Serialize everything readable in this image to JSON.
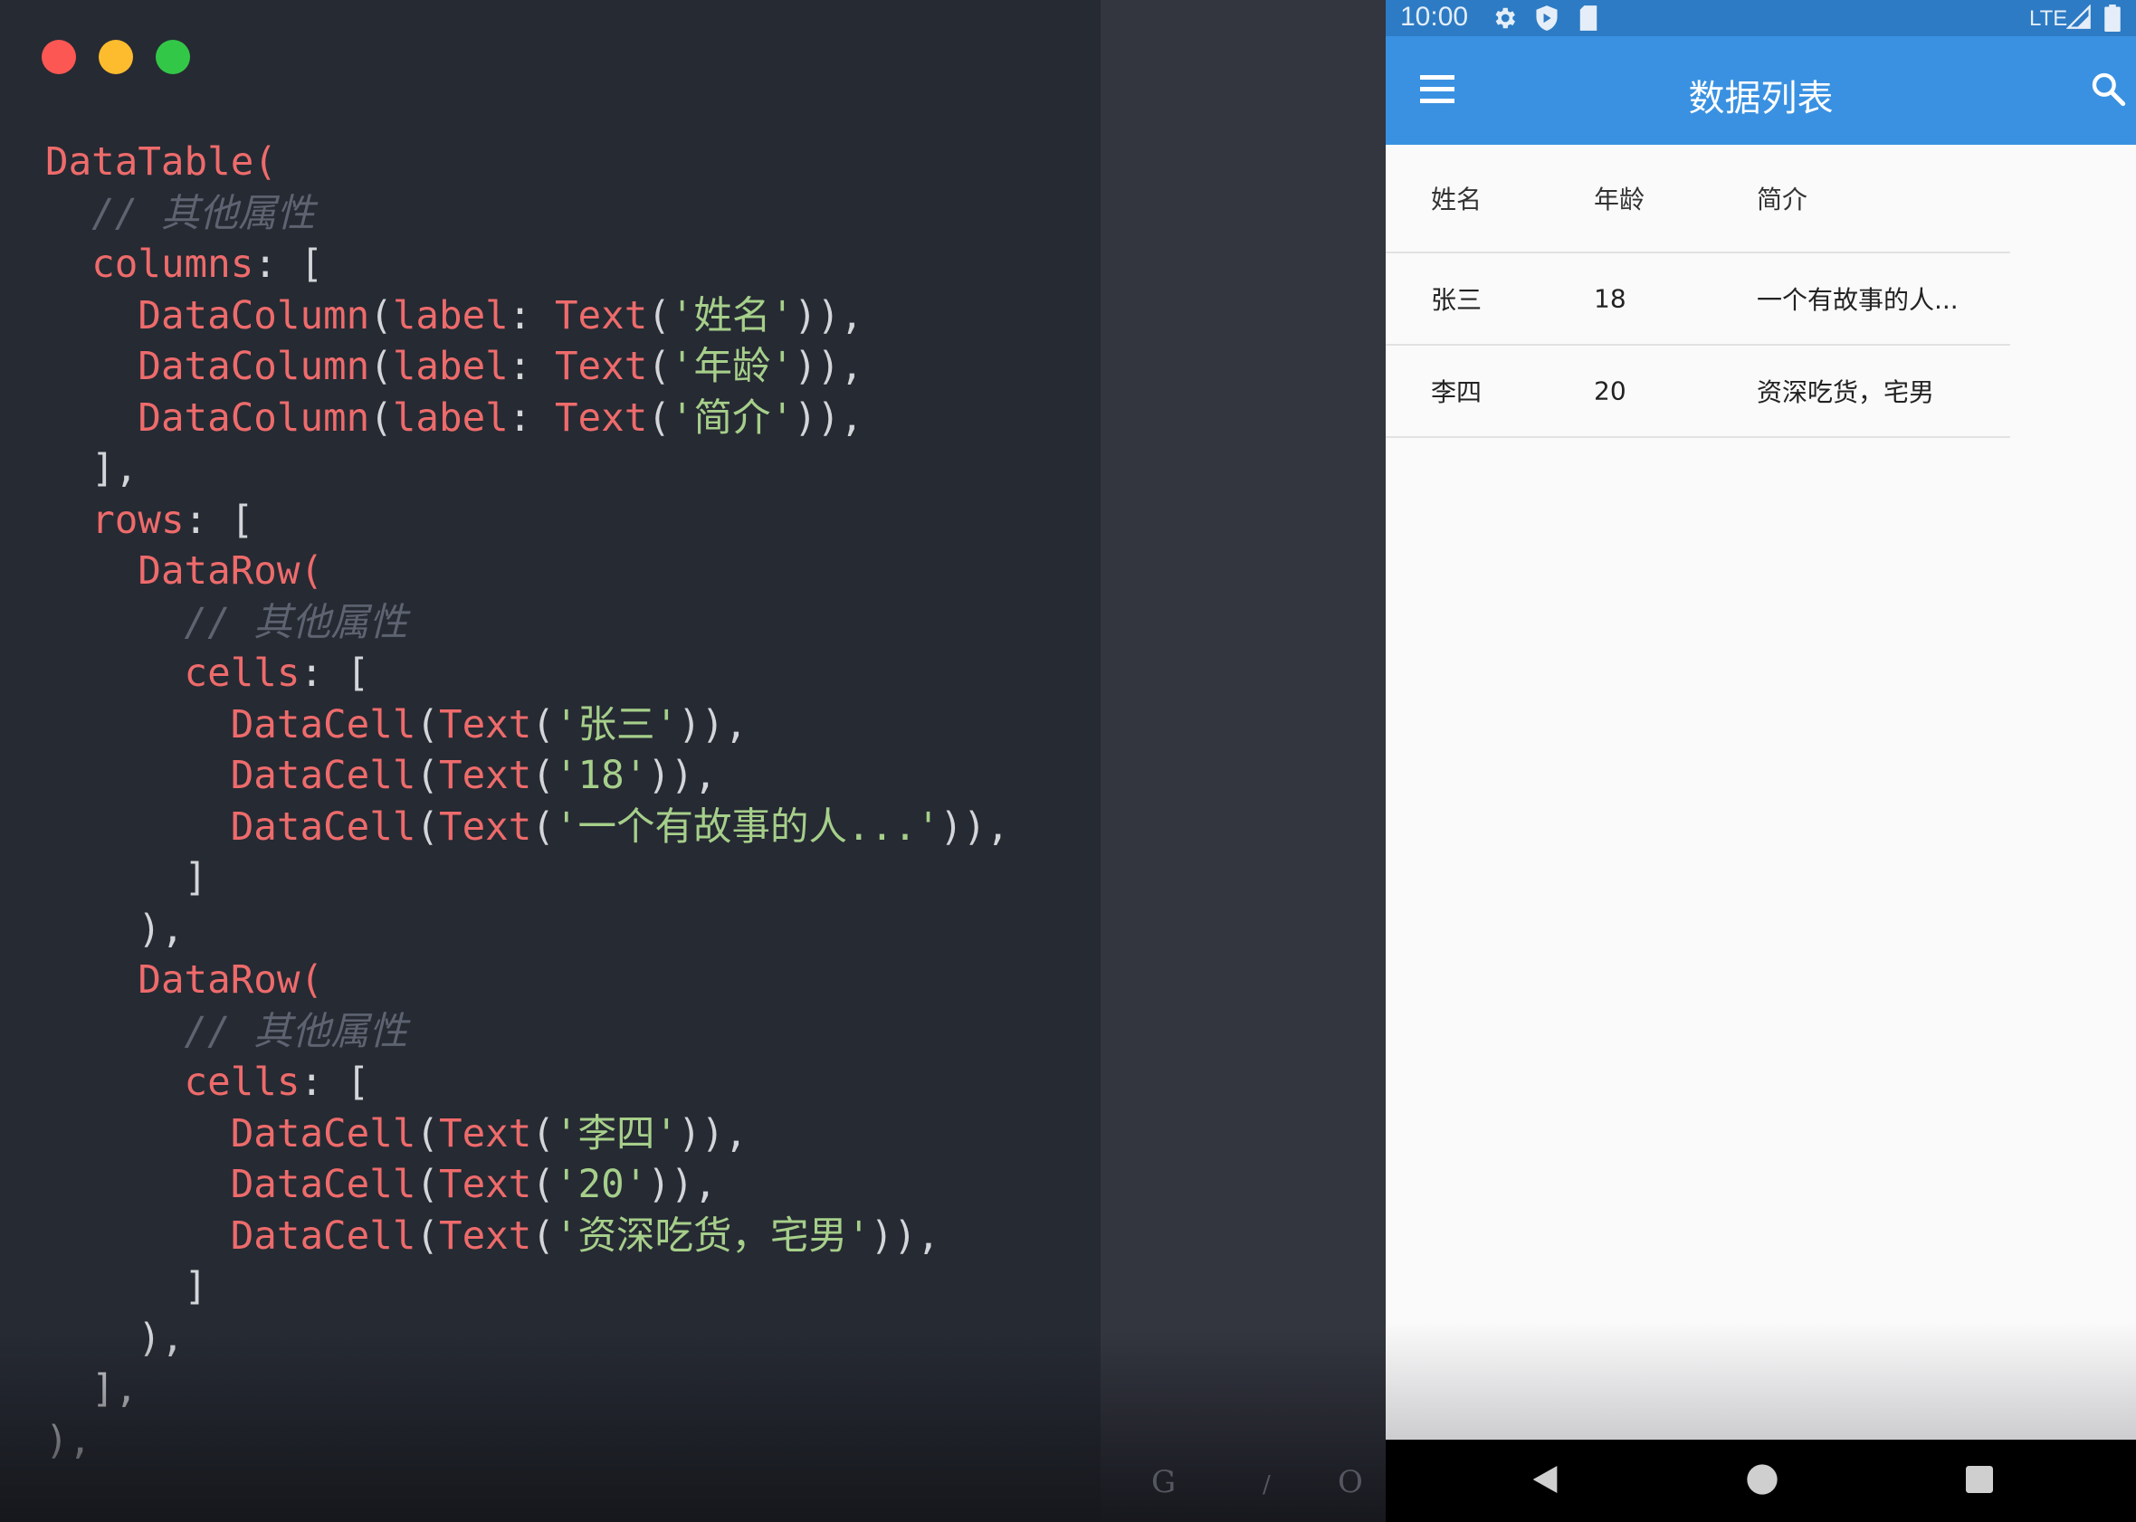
{
  "editor": {
    "lines": [
      [
        {
          "t": "DataTable(",
          "c": "k"
        }
      ],
      [
        {
          "t": "  "
        },
        {
          "t": "// 其他属性",
          "c": "c"
        }
      ],
      [
        {
          "t": "  "
        },
        {
          "t": "columns",
          "c": "k"
        },
        {
          "t": ": ["
        }
      ],
      [
        {
          "t": "    "
        },
        {
          "t": "DataColumn",
          "c": "k"
        },
        {
          "t": "("
        },
        {
          "t": "label",
          "c": "k"
        },
        {
          "t": ": "
        },
        {
          "t": "Text",
          "c": "k"
        },
        {
          "t": "("
        },
        {
          "t": "'姓名'",
          "c": "s"
        },
        {
          "t": ")),"
        }
      ],
      [
        {
          "t": "    "
        },
        {
          "t": "DataColumn",
          "c": "k"
        },
        {
          "t": "("
        },
        {
          "t": "label",
          "c": "k"
        },
        {
          "t": ": "
        },
        {
          "t": "Text",
          "c": "k"
        },
        {
          "t": "("
        },
        {
          "t": "'年龄'",
          "c": "s"
        },
        {
          "t": ")),"
        }
      ],
      [
        {
          "t": "    "
        },
        {
          "t": "DataColumn",
          "c": "k"
        },
        {
          "t": "("
        },
        {
          "t": "label",
          "c": "k"
        },
        {
          "t": ": "
        },
        {
          "t": "Text",
          "c": "k"
        },
        {
          "t": "("
        },
        {
          "t": "'简介'",
          "c": "s"
        },
        {
          "t": ")),"
        }
      ],
      [
        {
          "t": "  ],"
        }
      ],
      [
        {
          "t": "  "
        },
        {
          "t": "rows",
          "c": "k"
        },
        {
          "t": ": ["
        }
      ],
      [
        {
          "t": "    "
        },
        {
          "t": "DataRow(",
          "c": "k"
        }
      ],
      [
        {
          "t": "      "
        },
        {
          "t": "// 其他属性",
          "c": "c"
        }
      ],
      [
        {
          "t": "      "
        },
        {
          "t": "cells",
          "c": "k"
        },
        {
          "t": ": ["
        }
      ],
      [
        {
          "t": "        "
        },
        {
          "t": "DataCell",
          "c": "k"
        },
        {
          "t": "("
        },
        {
          "t": "Text",
          "c": "k"
        },
        {
          "t": "("
        },
        {
          "t": "'张三'",
          "c": "s"
        },
        {
          "t": ")),"
        }
      ],
      [
        {
          "t": "        "
        },
        {
          "t": "DataCell",
          "c": "k"
        },
        {
          "t": "("
        },
        {
          "t": "Text",
          "c": "k"
        },
        {
          "t": "("
        },
        {
          "t": "'18'",
          "c": "s"
        },
        {
          "t": ")),"
        }
      ],
      [
        {
          "t": "        "
        },
        {
          "t": "DataCell",
          "c": "k"
        },
        {
          "t": "("
        },
        {
          "t": "Text",
          "c": "k"
        },
        {
          "t": "("
        },
        {
          "t": "'一个有故事的人...'",
          "c": "s"
        },
        {
          "t": ")),"
        }
      ],
      [
        {
          "t": "      ]"
        }
      ],
      [
        {
          "t": "    ),"
        }
      ],
      [
        {
          "t": "    "
        },
        {
          "t": "DataRow(",
          "c": "k"
        }
      ],
      [
        {
          "t": "      "
        },
        {
          "t": "// 其他属性",
          "c": "c"
        }
      ],
      [
        {
          "t": "      "
        },
        {
          "t": "cells",
          "c": "k"
        },
        {
          "t": ": ["
        }
      ],
      [
        {
          "t": "        "
        },
        {
          "t": "DataCell",
          "c": "k"
        },
        {
          "t": "("
        },
        {
          "t": "Text",
          "c": "k"
        },
        {
          "t": "("
        },
        {
          "t": "'李四'",
          "c": "s"
        },
        {
          "t": ")),"
        }
      ],
      [
        {
          "t": "        "
        },
        {
          "t": "DataCell",
          "c": "k"
        },
        {
          "t": "("
        },
        {
          "t": "Text",
          "c": "k"
        },
        {
          "t": "("
        },
        {
          "t": "'20'",
          "c": "s"
        },
        {
          "t": ")),"
        }
      ],
      [
        {
          "t": "        "
        },
        {
          "t": "DataCell",
          "c": "k"
        },
        {
          "t": "("
        },
        {
          "t": "Text",
          "c": "k"
        },
        {
          "t": "("
        },
        {
          "t": "'资深吃货，宅男'",
          "c": "s"
        },
        {
          "t": ")),"
        }
      ],
      [
        {
          "t": "      ]"
        }
      ],
      [
        {
          "t": "    ),"
        }
      ],
      [
        {
          "t": "  ],"
        }
      ],
      [
        {
          "t": "),"
        }
      ]
    ]
  },
  "watermark": [
    "G",
    "/",
    "O"
  ],
  "phone": {
    "status_bar": {
      "time": "10:00",
      "network": "LTE",
      "icons": [
        "gear-icon",
        "shield-icon",
        "sim-card-icon",
        "signal-icon",
        "battery-icon"
      ]
    },
    "app_bar": {
      "title": "数据列表",
      "icons": [
        "menu-icon",
        "search-icon"
      ]
    },
    "table": {
      "columns": [
        "姓名",
        "年龄",
        "简介"
      ],
      "rows": [
        [
          "张三",
          "18",
          "一个有故事的人..."
        ],
        [
          "李四",
          "20",
          "资深吃货，宅男"
        ]
      ]
    },
    "nav_bar": {
      "icons": [
        "back-icon",
        "home-icon",
        "recents-icon"
      ]
    }
  },
  "colors": {
    "editor_bg": "#262a33",
    "keyword": "#ee6b6b",
    "string": "#a6cf8a",
    "comment": "#5d6370",
    "status_bar": "#2d7bc4",
    "app_bar": "#3a91e1"
  }
}
